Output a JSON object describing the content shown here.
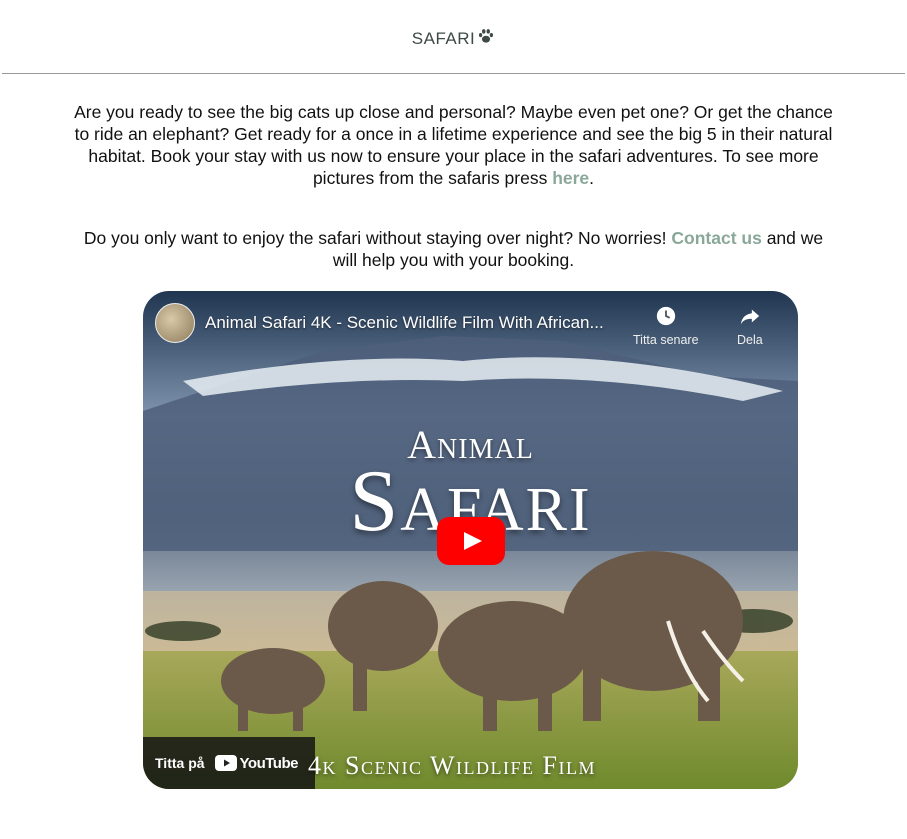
{
  "header": {
    "brand": "SAFARI",
    "brand_icon": "paw-icon"
  },
  "intro": {
    "text": "Are you ready to see the big cats up close and personal? Maybe even pet one? Or get the chance to ride an elephant? Get ready for a once in a lifetime experience and see the big 5 in their natural habitat. Book your stay with us now to ensure your place in the safari adventures. To see more pictures from the safaris press ",
    "link_label": "here",
    "end": "."
  },
  "contact": {
    "text": "Do you only want to enjoy the safari without staying over night? No worries! ",
    "link_label": "Contact us",
    "after": " and we will help you with your booking."
  },
  "video": {
    "title": "Animal Safari 4K - Scenic Wildlife Film With African...",
    "watch_later": "Titta senare",
    "share": "Dela",
    "overlay_top": "Animal",
    "overlay_main": "Safari",
    "overlay_bottom": "4k Scenic Wildlife Film",
    "watch_on": "Titta på",
    "platform": "YouTube"
  },
  "colors": {
    "link": "#8aa89a",
    "brand": "#3d4a45",
    "play_red": "#ff0000"
  }
}
